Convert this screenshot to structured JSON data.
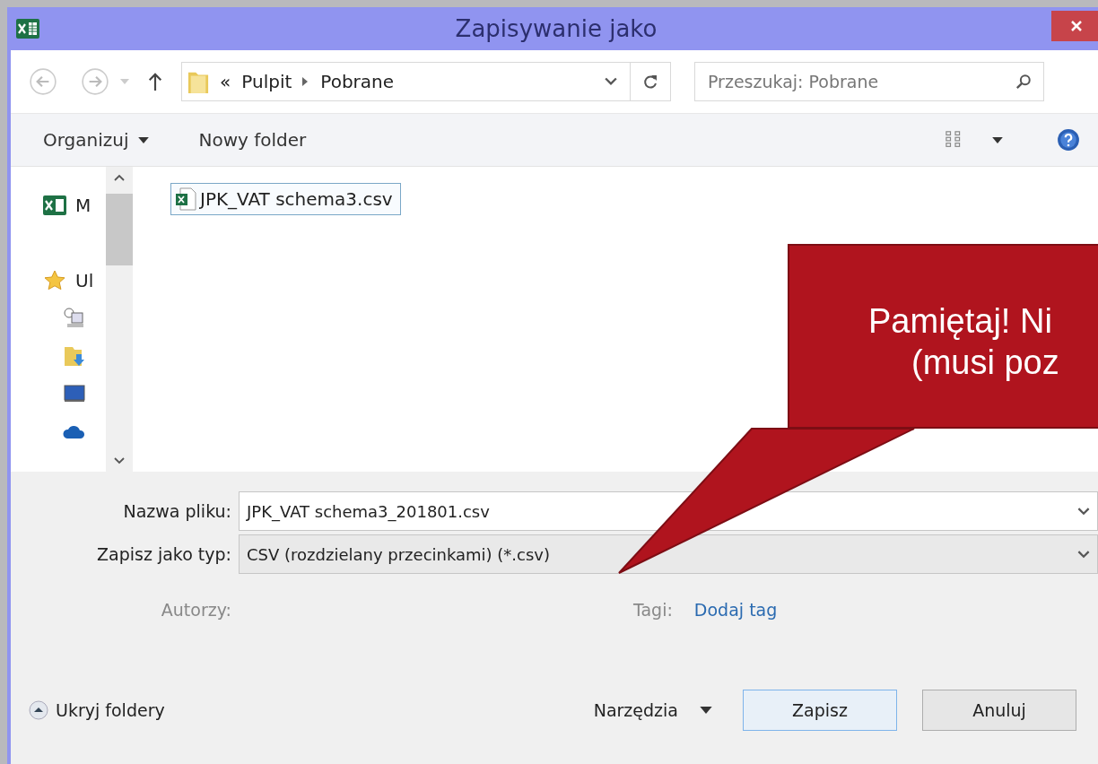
{
  "window": {
    "title": "Zapisywanie jako"
  },
  "address_bar": {
    "overflow": "«",
    "path": [
      "Pulpit",
      "Pobrane"
    ]
  },
  "search": {
    "placeholder": "Przeszukaj: Pobrane"
  },
  "toolbar": {
    "organize": "Organizuj",
    "new_folder": "Nowy folder"
  },
  "nav_pane": {
    "items": [
      {
        "kind": "excel",
        "label": "M"
      },
      {
        "kind": "favorites",
        "label": "Ul"
      },
      {
        "kind": "recent"
      },
      {
        "kind": "downloads"
      },
      {
        "kind": "desktop"
      },
      {
        "kind": "cloud"
      }
    ]
  },
  "files": [
    {
      "name": "JPK_VAT schema3.csv",
      "selected": true
    }
  ],
  "callout": {
    "lines": [
      "Pamiętaj! Ni",
      "(musi poz"
    ]
  },
  "form": {
    "filename_label": "Nazwa pliku:",
    "filename": "JPK_VAT schema3_201801.csv",
    "type_label": "Zapisz jako typ:",
    "type": "CSV (rozdzielany przecinkami) (*.csv)",
    "authors_label": "Autorzy:",
    "tags_label": "Tagi:",
    "tags_link": "Dodaj tag"
  },
  "footer": {
    "hide_folders": "Ukryj foldery",
    "tools": "Narzędzia",
    "save": "Zapisz",
    "cancel": "Anuluj"
  }
}
